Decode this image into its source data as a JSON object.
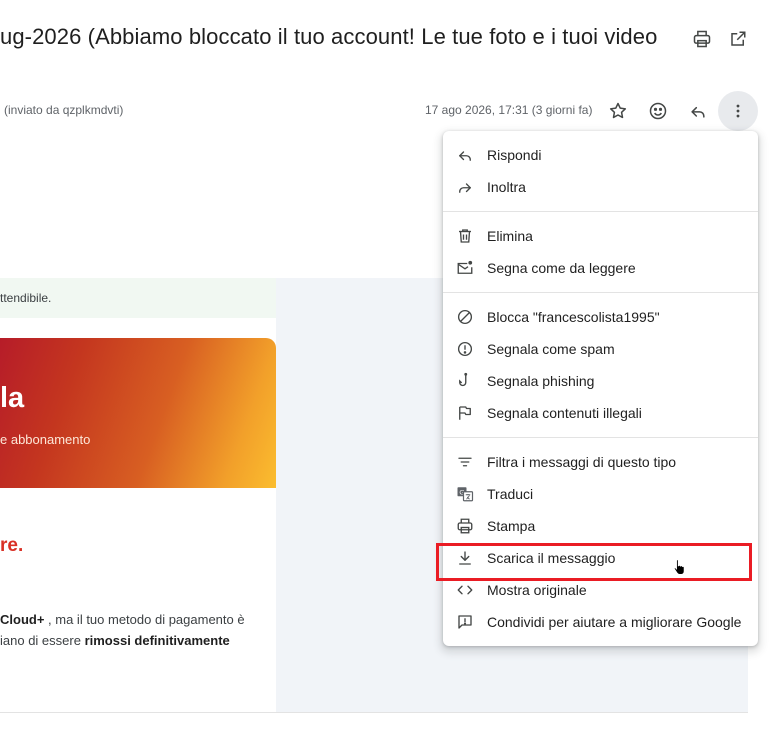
{
  "header": {
    "subject": "ug-2026 (Abbiamo bloccato il tuo account! Le tue foto e i tuoi video",
    "print_icon": "print-icon",
    "open_new_window_icon": "open-in-new-icon"
  },
  "message_meta": {
    "sent_via": "(inviato da qzplkmdvti)",
    "date": "17 ago 2026, 17:31 (3 giorni fa)"
  },
  "email_body": {
    "trust_note": "ttendibile.",
    "banner_title": "la",
    "banner_subtitle": "e abbonamento",
    "warning_heading": "re.",
    "paragraph_line1_bold": "Cloud+",
    "paragraph_line1_rest": " , ma il tuo metodo di pagamento è",
    "paragraph_line2_start": "iano di essere ",
    "paragraph_line2_bold": "rimossi definitivamente"
  },
  "menu": {
    "items": [
      {
        "label": "Rispondi",
        "icon": "reply-icon"
      },
      {
        "label": "Inoltra",
        "icon": "forward-icon"
      },
      {
        "label": "Elimina",
        "icon": "trash-icon"
      },
      {
        "label": "Segna come da leggere",
        "icon": "mark-unread-icon"
      },
      {
        "label": "Blocca \"francescolista1995\"",
        "icon": "block-icon"
      },
      {
        "label": "Segnala come spam",
        "icon": "report-spam-icon"
      },
      {
        "label": "Segnala phishing",
        "icon": "phishing-hook-icon"
      },
      {
        "label": "Segnala contenuti illegali",
        "icon": "flag-icon"
      },
      {
        "label": "Filtra i messaggi di questo tipo",
        "icon": "filter-icon"
      },
      {
        "label": "Traduci",
        "icon": "translate-icon"
      },
      {
        "label": "Stampa",
        "icon": "print-icon"
      },
      {
        "label": "Scarica il messaggio",
        "icon": "download-icon"
      },
      {
        "label": "Mostra originale",
        "icon": "code-icon"
      },
      {
        "label": "Condividi per aiutare a migliorare Google",
        "icon": "feedback-icon"
      }
    ],
    "highlighted_item": "Scarica il messaggio"
  },
  "colors": {
    "highlight_border": "#ea1c24",
    "warning_red": "#d93025",
    "menu_background": "#ffffff"
  }
}
